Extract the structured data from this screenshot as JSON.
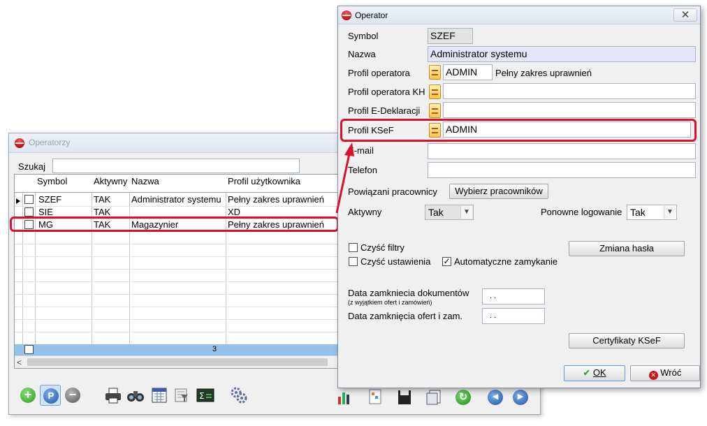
{
  "operatorzy": {
    "title": "Operatorzy",
    "search_label": "Szukaj",
    "search_value": "",
    "columns": [
      "Symbol",
      "Aktywny",
      "Nazwa",
      "Profil użytkownika"
    ],
    "rows": [
      {
        "symbol": "SZEF",
        "aktywny": "TAK",
        "nazwa": "Administrator systemu",
        "profil": "Pełny zakres uprawnień"
      },
      {
        "symbol": "SIE",
        "aktywny": "TAK",
        "nazwa": "",
        "profil": "XD"
      },
      {
        "symbol": "MG",
        "aktywny": "TAK",
        "nazwa": "Magazynier",
        "profil": "Pełny zakres uprawnień"
      }
    ],
    "footer_count": "3"
  },
  "operator": {
    "title": "Operator",
    "close_glyph": "✕",
    "labels": {
      "symbol": "Symbol",
      "nazwa": "Nazwa",
      "profil_operatora": "Profil operatora",
      "profil_operatora_kh": "Profil operatora KH",
      "profil_edeklaracji": "Profil E-Deklaracji",
      "profil_ksef": "Profil KSeF",
      "email": "E-mail",
      "telefon": "Telefon",
      "powiazani": "Powiązani pracownicy",
      "aktywny": "Aktywny",
      "ponowne": "Ponowne logowanie",
      "data_dok": "Data zamkniecia dokumentów",
      "data_dok_sub": "(z wyjątkiem ofert i zamówień)",
      "data_ofert": "Data zamknięcia ofert i zam."
    },
    "values": {
      "symbol": "SZEF",
      "nazwa": "Administrator systemu",
      "profil_operatora_code": "ADMIN",
      "profil_operatora_desc": "Pełny zakres uprawnień",
      "profil_operatora_kh": "",
      "profil_edeklaracji": "",
      "profil_ksef": "ADMIN",
      "email": "",
      "telefon": "",
      "aktywny": "Tak",
      "ponowne": "Tak",
      "data_dok": " .  .",
      "data_ofert": " .  ."
    },
    "buttons": {
      "wybierz": "Wybierz pracowników",
      "zmiana_hasla": "Zmiana hasła",
      "certyfikaty": "Certyfikaty KSeF",
      "ok": "OK",
      "wroc": "Wróć"
    },
    "checkboxes": {
      "czysc_filtry": {
        "label": "Czyść filtry",
        "checked": false
      },
      "czysc_ustawienia": {
        "label": "Czyść ustawienia",
        "checked": false
      },
      "auto_zamykanie": {
        "label": "Automatyczne zamykanie",
        "checked": true
      }
    }
  },
  "colors": {
    "highlight": "#d9112f",
    "grid_footer": "#95c2ec",
    "name_field_bg": "#e6e6fa"
  },
  "icons": {
    "toolbar": [
      "add-icon",
      "search-icon",
      "remove-icon",
      "print-icon",
      "binoculars-icon",
      "calendar-icon",
      "filter-icon",
      "sum-icon",
      "gears-icon"
    ],
    "toolbar_right": [
      "chart-icon",
      "report-icon",
      "save-icon",
      "copy-icon",
      "refresh-icon",
      "prev-icon",
      "next-icon"
    ]
  }
}
